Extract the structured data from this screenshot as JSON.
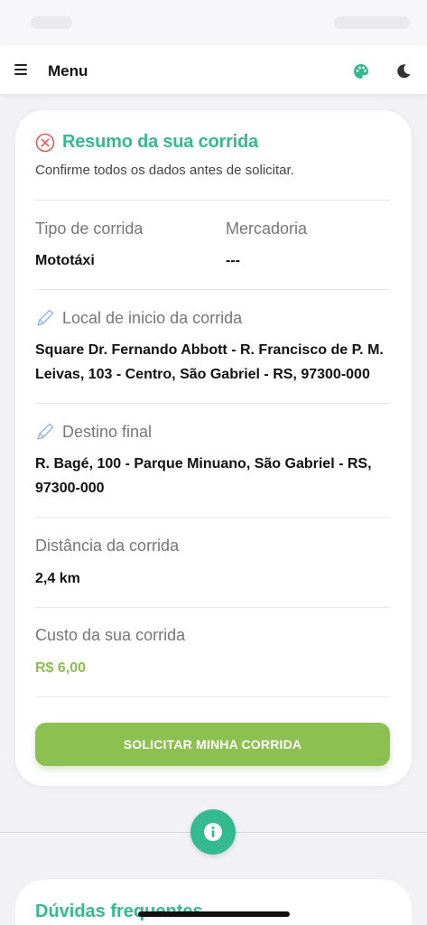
{
  "header": {
    "menu_label": "Menu",
    "icons": [
      "menu-icon",
      "palette-icon",
      "moon-icon"
    ]
  },
  "summary": {
    "title": "Resumo da sua corrida",
    "subtitle": "Confirme todos os dados antes de solicitar.",
    "ride_type_label": "Tipo de corrida",
    "ride_type_value": "Mototáxi",
    "goods_label": "Mercadoria",
    "goods_value": "---",
    "origin_label": "Local de inicio da corrida",
    "origin_value_line1": "Square Dr. Fernando Abbott - R. Francisco de P. M.",
    "origin_value_line2": "Leivas, 103 - Centro, São Gabriel - RS, 97300-000",
    "destination_label": "Destino final",
    "destination_value_line1": "R. Bagé, 100 - Parque Minuano, São Gabriel - RS,",
    "destination_value_line2": "97300-000",
    "distance_label": "Distância da corrida",
    "distance_value": "2,4 km",
    "cost_label": "Custo da sua corrida",
    "cost_value": "R$ 6,00",
    "submit_label": "SOLICITAR MINHA CORRIDA"
  },
  "faq": {
    "title": "Dúvidas frequentes"
  },
  "colors": {
    "accent_teal": "#33bb8f",
    "accent_green": "#8cc152",
    "background": "#f2f2f6"
  }
}
